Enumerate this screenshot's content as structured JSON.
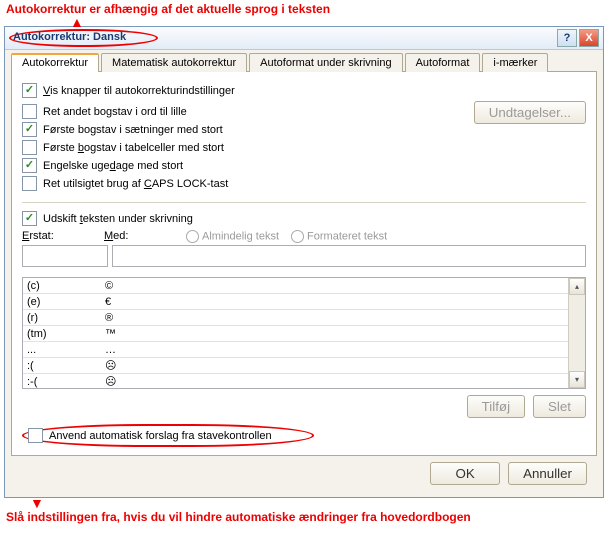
{
  "annotations": {
    "top": "Autokorrektur er afhængig af det aktuelle sprog i teksten",
    "bottom": "Slå indstillingen fra, hvis du vil hindre automatiske ændringer fra hovedordbogen"
  },
  "titlebar": {
    "title": "Autokorrektur: Dansk"
  },
  "tabs": {
    "t0": "Autokorrektur",
    "t1": "Matematisk autokorrektur",
    "t2": "Autoformat under skrivning",
    "t3": "Autoformat",
    "t4": "i-mærker"
  },
  "checks": {
    "c0": "Vis knapper til autokorrekturindstillinger",
    "c1": "Ret andet bogstav i ord til lille",
    "c2": "Første bogstav i sætninger med stort",
    "c3": "Første bogstav i tabelceller med stort",
    "c4": "Engelske ugedage med stort",
    "c5": "Ret utilsigtet brug af CAPS LOCK-tast",
    "c6": "Udskift teksten under skrivning",
    "c7": "Anvend automatisk forslag fra stavekontrollen"
  },
  "buttons": {
    "exceptions": "Undtagelser...",
    "add": "Tilføj",
    "delete": "Slet",
    "ok": "OK",
    "cancel": "Annuller"
  },
  "fields": {
    "replace": "Erstat:",
    "with": "Med:",
    "plain": "Almindelig tekst",
    "formatted": "Formateret tekst"
  },
  "table": {
    "r0": {
      "a": "(c)",
      "b": "©"
    },
    "r1": {
      "a": "(e)",
      "b": "€"
    },
    "r2": {
      "a": "(r)",
      "b": "®"
    },
    "r3": {
      "a": "(tm)",
      "b": "™"
    },
    "r4": {
      "a": "...",
      "b": "…"
    },
    "r5": {
      "a": ":(",
      "b": "☹"
    },
    "r6": {
      "a": ":-(",
      "b": "☹"
    }
  }
}
